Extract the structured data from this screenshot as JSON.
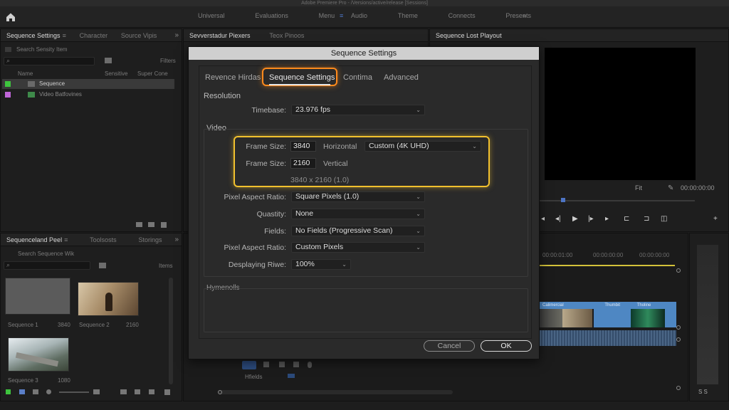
{
  "app": {
    "window_title": "Adobe Premiere Pro - /Versions/active/release [Sessions]",
    "workspaces": [
      "Universal",
      "Evaluations",
      "Menu",
      "Audio",
      "Theme",
      "Connects",
      "Presents"
    ]
  },
  "left_top_panel": {
    "tabs": [
      "Sequence Settings",
      "Character",
      "Source Vipis"
    ],
    "search_placeholder": "Search Sensity Item",
    "filters_label": "Filters",
    "columns": [
      "Name",
      "Sensitive",
      "Super Cone"
    ],
    "rows": [
      {
        "label": "Sequence",
        "color": "#3ec43e"
      },
      {
        "label": "Video Batfovines",
        "color": "#c066d9"
      }
    ]
  },
  "center_top_panel": {
    "tabs": [
      "Sevverstadur Piexers",
      "Teox Pinoos"
    ]
  },
  "right_top_panel": {
    "tabs": [
      "Sequence Lost Playout"
    ],
    "zoom_label": "Fit",
    "timecode": "00:00:00:00"
  },
  "left_bottom_panel": {
    "tabs": [
      "Sequenceland Peel",
      "Toolsosts",
      "Storings"
    ],
    "search_placeholder": "Search Sequence Wik",
    "items_label": "Items",
    "thumbs": [
      {
        "label": "Sequence 1",
        "value": "3840"
      },
      {
        "label": "Sequence 2",
        "value": "2160"
      },
      {
        "label": "Sequence 3",
        "value": "1080"
      }
    ]
  },
  "timeline": {
    "ruler": [
      "00:00:01:00",
      "00:00:00:00",
      "00:00:00:00"
    ],
    "track_label": "Hfields",
    "clip_labels": [
      "Calimercial",
      "Thumbit",
      "Tholine"
    ]
  },
  "dialog": {
    "title": "Sequence Settings",
    "tabs": [
      "Revence Hirdas",
      "Sequence Settings",
      "Contima",
      "Advanced"
    ],
    "active_tab": "Sequence Settings",
    "resolution_label": "Resolution",
    "timebase_label": "Timebase:",
    "timebase_value": "23.976 fps",
    "video_label": "Video",
    "frame_size_label_1": "Frame Size:",
    "frame_width": "3840",
    "horizontal_label": "Horizontal",
    "frame_preset": "Custom (4K UHD)",
    "frame_size_label_2": "Frame Size:",
    "frame_height": "2160",
    "vertical_label": "Vertical",
    "frame_summary": "3840 x 2160 (1.0)",
    "pixel_aspect_label_1": "Pixel Aspect Ratio:",
    "pixel_aspect_value_1": "Square Pixels (1.0)",
    "quality_label": "Quastity:",
    "quality_value": "None",
    "fields_label": "Fields:",
    "fields_value": "No Fields (Progressive Scan)",
    "pixel_aspect_label_2": "Pixel Aspect Ratio:",
    "pixel_aspect_value_2": "Custom Pixels",
    "display_label": "Desplaying Riwe:",
    "display_value": "100%",
    "presets_label": "Hymenolls",
    "cancel_label": "Cancel",
    "ok_label": "OK"
  },
  "colors": {
    "tab_highlight": "#ff8a1c",
    "group_highlight": "#f2c12e",
    "accent_blue": "#4d74c4"
  }
}
